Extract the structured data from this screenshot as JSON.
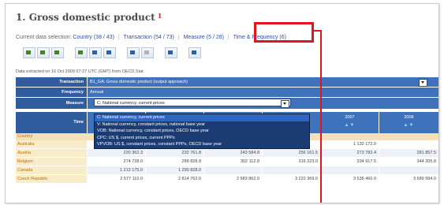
{
  "title": "1. Gross domestic product",
  "title_marker": "1",
  "selection": {
    "label": "Current data selection:",
    "items": [
      {
        "label": "Country (38 / 43)"
      },
      {
        "label": "Transaction (54 / 73)"
      },
      {
        "label": "Measure (5 / 28)"
      },
      {
        "label": "Time & Frequency (6)"
      }
    ]
  },
  "extracted_note": "Data extracted on 16 Oct 2009 07:27 UTC (GMT) from OECD.Stat",
  "params": {
    "transaction_label": "Transaction",
    "transaction_value": "B1_GA: Gross domestic product (output approach)",
    "frequency_label": "Frequency",
    "frequency_value": "Annual",
    "measure_label": "Measure",
    "measure_value": "C: National currency, current prices"
  },
  "measure_options": [
    "C: National currency, current prices",
    "V: National currency, constant prices, national base year",
    "VOB: National currency, constant prices, OECD base year",
    "CPC: US $, current prices, current PPPs",
    "VPVOB: US $, constant prices, constant PPPs, OECD base year"
  ],
  "time_label": "Time",
  "years": [
    "2007",
    "2008"
  ],
  "country_header": "Country",
  "rows": [
    {
      "country": "Australia",
      "values": [
        "",
        "",
        "",
        "",
        "1 132 172.0",
        ""
      ]
    },
    {
      "country": "Austria",
      "values": [
        "220 362.3",
        "232 761.8",
        "243 584.8",
        "256 161.5",
        "273 782.4",
        "281 857.5"
      ]
    },
    {
      "country": "Belgium",
      "values": [
        "274 738.0",
        "289 828.8",
        "302 112.8",
        "316 223.0",
        "334 917.5",
        "344 205.8"
      ]
    },
    {
      "country": "Canada",
      "values": [
        "1 213 175.0",
        "1 290 828.0",
        "",
        "",
        "",
        ""
      ]
    },
    {
      "country": "Czech Republic",
      "values": [
        "2 577 110.0",
        "2 814 762.0",
        "2 983 862.0",
        "3 222 369.0",
        "3 535 460.0",
        "3 689 994.0"
      ]
    }
  ],
  "colors": {
    "accent_red": "#e0151f",
    "header_blue": "#2f5c9c",
    "link_blue": "#2d51a0"
  }
}
